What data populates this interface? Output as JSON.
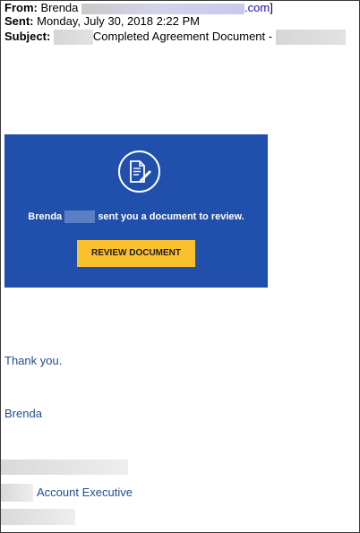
{
  "header": {
    "from_label": "From:",
    "from_name": "Brenda",
    "from_domain": ".com",
    "from_close": "]",
    "sent_label": "Sent:",
    "sent_value": "Monday, July 30, 2018 2:22 PM",
    "subject_label": "Subject:",
    "subject_value": "Completed Agreement Document -"
  },
  "banner": {
    "icon": "document-pen-icon",
    "sender_name": "Brenda",
    "message": "sent you a document to review.",
    "button_label": "REVIEW DOCUMENT",
    "background": "#2050ac",
    "button_color": "#fbc02d"
  },
  "body": {
    "thanks": "Thank you.",
    "signature_name": "Brenda",
    "signature_title": "Account Executive"
  },
  "colors": {
    "link": "#1a0dab",
    "body_text": "#1f4e8c"
  }
}
